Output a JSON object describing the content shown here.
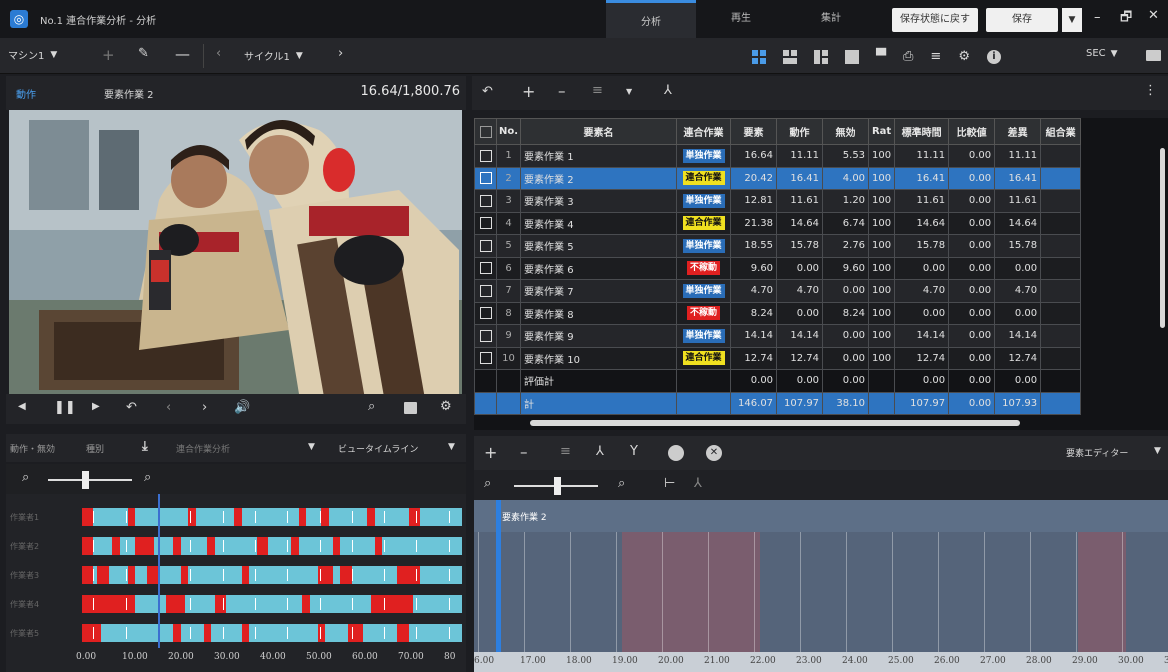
{
  "window": {
    "title": "No.1 連合作業分析 - 分析",
    "tabs": [
      "分析",
      "再生",
      "集計"
    ],
    "restore_label": "保存状態に戻す",
    "save_label": "保存",
    "minimize": "–",
    "maximize": "🗗",
    "close": "✕"
  },
  "toolbar": {
    "machine": "マシン1",
    "cycle": "サイクル1",
    "unit": "SEC"
  },
  "video": {
    "mode": "動作",
    "element": "要素作業 2",
    "time": "16.64/1,800.76"
  },
  "table": {
    "headers": [
      "No.",
      "要素名",
      "連合作業",
      "要素",
      "動作",
      "無効",
      "Rat",
      "標準時間",
      "比較値",
      "差異",
      "組合業"
    ],
    "rows": [
      {
        "no": "1",
        "name": "要素作業 1",
        "type": "単独作業",
        "c": "blue",
        "v": [
          "16.64",
          "11.11",
          "5.53",
          "100",
          "11.11",
          "0.00",
          "11.11"
        ]
      },
      {
        "no": "2",
        "name": "要素作業 2",
        "type": "連合作業",
        "c": "yellow",
        "v": [
          "20.42",
          "16.41",
          "4.00",
          "100",
          "16.41",
          "0.00",
          "16.41"
        ]
      },
      {
        "no": "3",
        "name": "要素作業 3",
        "type": "単独作業",
        "c": "blue",
        "v": [
          "12.81",
          "11.61",
          "1.20",
          "100",
          "11.61",
          "0.00",
          "11.61"
        ]
      },
      {
        "no": "4",
        "name": "要素作業 4",
        "type": "連合作業",
        "c": "yellow",
        "v": [
          "21.38",
          "14.64",
          "6.74",
          "100",
          "14.64",
          "0.00",
          "14.64"
        ]
      },
      {
        "no": "5",
        "name": "要素作業 5",
        "type": "単独作業",
        "c": "blue",
        "v": [
          "18.55",
          "15.78",
          "2.76",
          "100",
          "15.78",
          "0.00",
          "15.78"
        ]
      },
      {
        "no": "6",
        "name": "要素作業 6",
        "type": "不稼動",
        "c": "red",
        "v": [
          "9.60",
          "0.00",
          "9.60",
          "100",
          "0.00",
          "0.00",
          "0.00"
        ]
      },
      {
        "no": "7",
        "name": "要素作業 7",
        "type": "単独作業",
        "c": "blue",
        "v": [
          "4.70",
          "4.70",
          "0.00",
          "100",
          "4.70",
          "0.00",
          "4.70"
        ]
      },
      {
        "no": "8",
        "name": "要素作業 8",
        "type": "不稼動",
        "c": "red",
        "v": [
          "8.24",
          "0.00",
          "8.24",
          "100",
          "0.00",
          "0.00",
          "0.00"
        ]
      },
      {
        "no": "9",
        "name": "要素作業 9",
        "type": "単独作業",
        "c": "blue",
        "v": [
          "14.14",
          "14.14",
          "0.00",
          "100",
          "14.14",
          "0.00",
          "14.14"
        ]
      },
      {
        "no": "10",
        "name": "要素作業 10",
        "type": "連合作業",
        "c": "yellow",
        "v": [
          "12.74",
          "12.74",
          "0.00",
          "100",
          "12.74",
          "0.00",
          "12.74"
        ]
      }
    ],
    "subtotal": {
      "label": "評価計",
      "v": [
        "0.00",
        "0.00",
        "0.00",
        "",
        "0.00",
        "0.00",
        "0.00"
      ]
    },
    "total": {
      "label": "計",
      "v": [
        "146.07",
        "107.97",
        "38.10",
        "",
        "107.97",
        "0.00",
        "107.93"
      ]
    }
  },
  "left_panel": {
    "tab1": "動作・無効",
    "tab2": "種別",
    "tab3": "連合作業分析",
    "view": "ビュータイムライン",
    "rows": [
      "作業者1",
      "作業者2",
      "作業者3",
      "作業者4",
      "作業者5"
    ],
    "ticks": [
      "0.00",
      "10.00",
      "20.00",
      "30.00",
      "40.00",
      "50.00",
      "60.00",
      "70.00",
      "80"
    ]
  },
  "right_panel": {
    "editor": "要素エディター",
    "element_label": "要素作業 2",
    "ticks": [
      "6.00",
      "17.00",
      "18.00",
      "19.00",
      "20.00",
      "21.00",
      "22.00",
      "23.00",
      "24.00",
      "25.00",
      "26.00",
      "27.00",
      "28.00",
      "29.00",
      "30.00",
      "31"
    ]
  },
  "colors": {
    "selected": "#2e74c0",
    "blue": "#2a6db8",
    "yellow": "#f0e020",
    "red": "#e02020",
    "lane": "#6cc5d8"
  }
}
